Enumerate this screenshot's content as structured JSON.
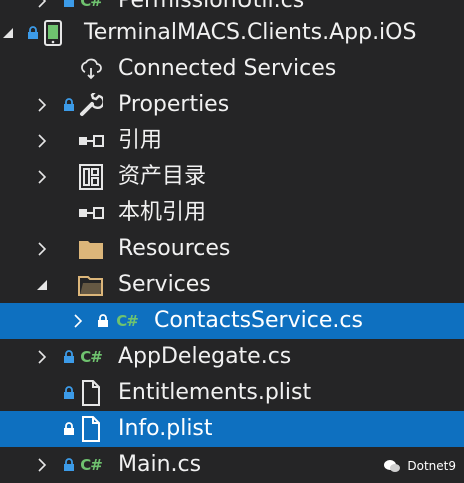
{
  "tree": {
    "rows": [
      {
        "label": "PermissionUtil.cs"
      },
      {
        "label": "TerminalMACS.Clients.App.iOS"
      },
      {
        "label": "Connected Services"
      },
      {
        "label": "Properties"
      },
      {
        "label": "引用"
      },
      {
        "label": "资产目录"
      },
      {
        "label": "本机引用"
      },
      {
        "label": "Resources"
      },
      {
        "label": "Services"
      },
      {
        "label": "ContactsService.cs"
      },
      {
        "label": "AppDelegate.cs"
      },
      {
        "label": "Entitlements.plist"
      },
      {
        "label": "Info.plist"
      },
      {
        "label": "Main.cs"
      }
    ]
  },
  "icons": {
    "csharp_badge": "C#",
    "folder": "folder-icon",
    "references": "references-icon",
    "asset_catalog": "asset-catalog-icon",
    "wrench": "wrench-icon",
    "cloud": "cloud-icon",
    "file": "file-icon",
    "ios_project": "ios-project-icon",
    "lock": "lock-icon"
  },
  "colors": {
    "background": "#252526",
    "selection": "#0e70c0",
    "text": "#f1f1f1",
    "csharp_green": "#6fc36f",
    "lock_blue": "#3c9be8",
    "folder_tan": "#dcb67a"
  },
  "watermark": {
    "text": "Dotnet9"
  }
}
